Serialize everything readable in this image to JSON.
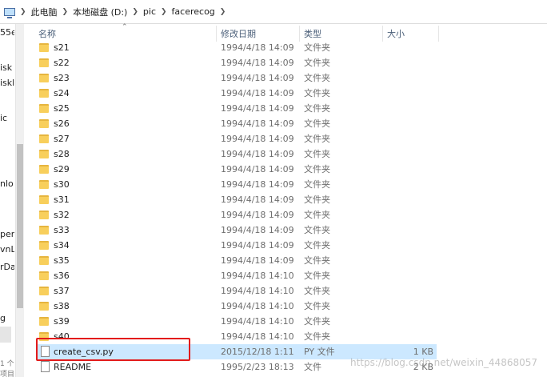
{
  "breadcrumb": {
    "items": [
      "此电脑",
      "本地磁盘 (D:)",
      "pic",
      "facerecog"
    ]
  },
  "nav_pane": {
    "items": [
      "55e",
      "isk",
      "iskl",
      "ic",
      "nlo",
      "per",
      "vnL",
      "rDa",
      "g"
    ]
  },
  "columns": {
    "name": "名称",
    "date": "修改日期",
    "type": "类型",
    "size": "大小"
  },
  "files": [
    {
      "name": "s21",
      "date": "1994/4/18 14:09",
      "type": "文件夹",
      "size": "",
      "kind": "folder"
    },
    {
      "name": "s22",
      "date": "1994/4/18 14:09",
      "type": "文件夹",
      "size": "",
      "kind": "folder"
    },
    {
      "name": "s23",
      "date": "1994/4/18 14:09",
      "type": "文件夹",
      "size": "",
      "kind": "folder"
    },
    {
      "name": "s24",
      "date": "1994/4/18 14:09",
      "type": "文件夹",
      "size": "",
      "kind": "folder"
    },
    {
      "name": "s25",
      "date": "1994/4/18 14:09",
      "type": "文件夹",
      "size": "",
      "kind": "folder"
    },
    {
      "name": "s26",
      "date": "1994/4/18 14:09",
      "type": "文件夹",
      "size": "",
      "kind": "folder"
    },
    {
      "name": "s27",
      "date": "1994/4/18 14:09",
      "type": "文件夹",
      "size": "",
      "kind": "folder"
    },
    {
      "name": "s28",
      "date": "1994/4/18 14:09",
      "type": "文件夹",
      "size": "",
      "kind": "folder"
    },
    {
      "name": "s29",
      "date": "1994/4/18 14:09",
      "type": "文件夹",
      "size": "",
      "kind": "folder"
    },
    {
      "name": "s30",
      "date": "1994/4/18 14:09",
      "type": "文件夹",
      "size": "",
      "kind": "folder"
    },
    {
      "name": "s31",
      "date": "1994/4/18 14:09",
      "type": "文件夹",
      "size": "",
      "kind": "folder"
    },
    {
      "name": "s32",
      "date": "1994/4/18 14:09",
      "type": "文件夹",
      "size": "",
      "kind": "folder"
    },
    {
      "name": "s33",
      "date": "1994/4/18 14:09",
      "type": "文件夹",
      "size": "",
      "kind": "folder"
    },
    {
      "name": "s34",
      "date": "1994/4/18 14:09",
      "type": "文件夹",
      "size": "",
      "kind": "folder"
    },
    {
      "name": "s35",
      "date": "1994/4/18 14:09",
      "type": "文件夹",
      "size": "",
      "kind": "folder"
    },
    {
      "name": "s36",
      "date": "1994/4/18 14:10",
      "type": "文件夹",
      "size": "",
      "kind": "folder"
    },
    {
      "name": "s37",
      "date": "1994/4/18 14:10",
      "type": "文件夹",
      "size": "",
      "kind": "folder"
    },
    {
      "name": "s38",
      "date": "1994/4/18 14:10",
      "type": "文件夹",
      "size": "",
      "kind": "folder"
    },
    {
      "name": "s39",
      "date": "1994/4/18 14:10",
      "type": "文件夹",
      "size": "",
      "kind": "folder"
    },
    {
      "name": "s40",
      "date": "1994/4/18 14:10",
      "type": "文件夹",
      "size": "",
      "kind": "folder"
    },
    {
      "name": "create_csv.py",
      "date": "2015/12/18 1:11",
      "type": "PY 文件",
      "size": "1 KB",
      "kind": "file",
      "selected": true
    },
    {
      "name": "README",
      "date": "1995/2/23 18:13",
      "type": "文件",
      "size": "2 KB",
      "kind": "file"
    }
  ],
  "watermark": "https://blog.csdn.net/weixin_44868057",
  "status_text": "1 个项目"
}
